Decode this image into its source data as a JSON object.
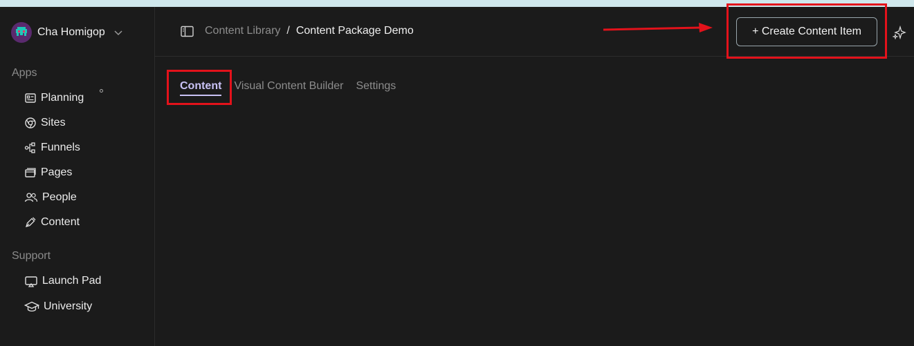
{
  "workspace": {
    "name": "Cha Homigop"
  },
  "sidebar": {
    "apps_label": "Apps",
    "apps": [
      {
        "label": "Planning",
        "icon": "planning-icon"
      },
      {
        "label": "Sites",
        "icon": "chrome-icon"
      },
      {
        "label": "Funnels",
        "icon": "funnel-icon"
      },
      {
        "label": "Pages",
        "icon": "pages-icon"
      },
      {
        "label": "People",
        "icon": "people-icon"
      },
      {
        "label": "Content",
        "icon": "pen-icon"
      }
    ],
    "support_label": "Support",
    "support": [
      {
        "label": "Launch Pad",
        "icon": "launch-pad-icon"
      },
      {
        "label": "University",
        "icon": "graduation-cap-icon"
      }
    ]
  },
  "header": {
    "breadcrumb": {
      "parent": "Content Library",
      "separator": "/",
      "current": "Content Package Demo"
    },
    "create_button_label": "+ Create Content Item"
  },
  "tabs": [
    {
      "label": "Content",
      "active": true
    },
    {
      "label": "Visual Content Builder",
      "active": false
    },
    {
      "label": "Settings",
      "active": false
    }
  ],
  "colors": {
    "background": "#1b1b1b",
    "accent_tab": "#c9c2f5",
    "annotation_red": "#e3121b"
  }
}
